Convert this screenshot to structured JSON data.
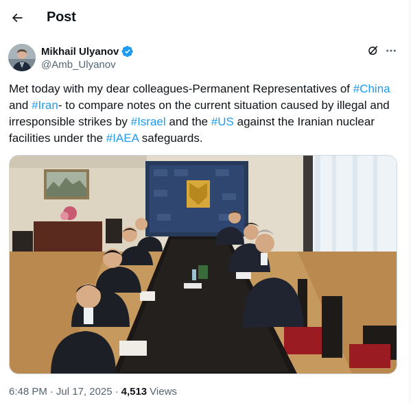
{
  "header": {
    "title": "Post",
    "back_icon": "arrow-left-icon"
  },
  "author": {
    "name": "Mikhail Ulyanov",
    "handle": "@Amb_Ulyanov",
    "verified": true,
    "verified_color": "#1d9bf0"
  },
  "actions": {
    "grok_icon": "grok-icon",
    "more_icon": "more-icon"
  },
  "tweet": {
    "t1": "Met today with my dear colleagues-Permanent Representatives of ",
    "h1": "#China",
    "t2": " and ",
    "h2": "#Iran",
    "t3": "- to compare notes on the current situation caused by illegal and irresponsible strikes by ",
    "h3": "#Israel",
    "t4": " and the ",
    "h4": "#US",
    "t5": " against the Iranian nuclear facilities under the ",
    "h5": "#IAEA",
    "t6": " safeguards."
  },
  "meta": {
    "time": "6:48 PM",
    "sep1": "·",
    "date": "Jul 17, 2025",
    "sep2": "·",
    "views_count": "4,513",
    "views_label": "Views"
  },
  "colors": {
    "link": "#1d9bf0",
    "muted": "#536471",
    "text": "#0f1419"
  }
}
